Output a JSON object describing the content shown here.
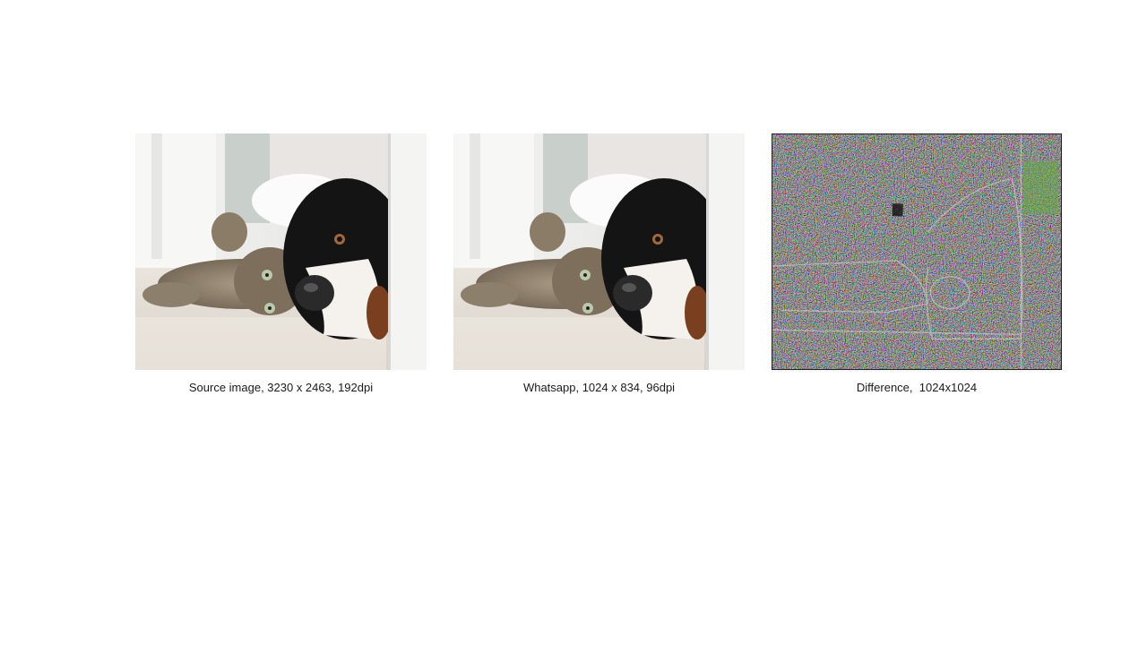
{
  "panels": [
    {
      "caption": "Source image, 3230 x 2463, 192dpi",
      "image": "photo-cat-and-dog"
    },
    {
      "caption": "Whatsapp, 1024 x 834, 96dpi",
      "image": "photo-cat-and-dog"
    },
    {
      "caption": "Difference,  1024x1024",
      "image": "difference-map-cat-and-dog"
    }
  ]
}
